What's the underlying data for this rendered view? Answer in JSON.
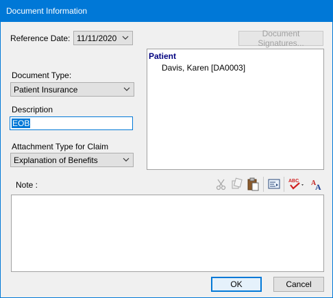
{
  "window": {
    "title": "Document Information"
  },
  "reference_date": {
    "label": "Reference Date:",
    "value": "11/11/2020"
  },
  "buttons": {
    "signatures": "Document Signatures...",
    "ok": "OK",
    "cancel": "Cancel"
  },
  "document_type": {
    "label": "Document Type:",
    "value": "Patient Insurance"
  },
  "description": {
    "label": "Description",
    "value": "EOB"
  },
  "attachment": {
    "label": "Attachment Type for Claim",
    "value": "Explanation of Benefits"
  },
  "patient_panel": {
    "heading": "Patient",
    "name": "Davis, Karen [DA0003]"
  },
  "note": {
    "label": "Note :",
    "value": ""
  },
  "toolbar_icons": [
    "cut-icon",
    "copy-icon",
    "paste-icon",
    "insert-text-icon",
    "spell-check-icon",
    "font-icon"
  ],
  "colors": {
    "accent": "#0078d7",
    "heading": "#000080"
  }
}
